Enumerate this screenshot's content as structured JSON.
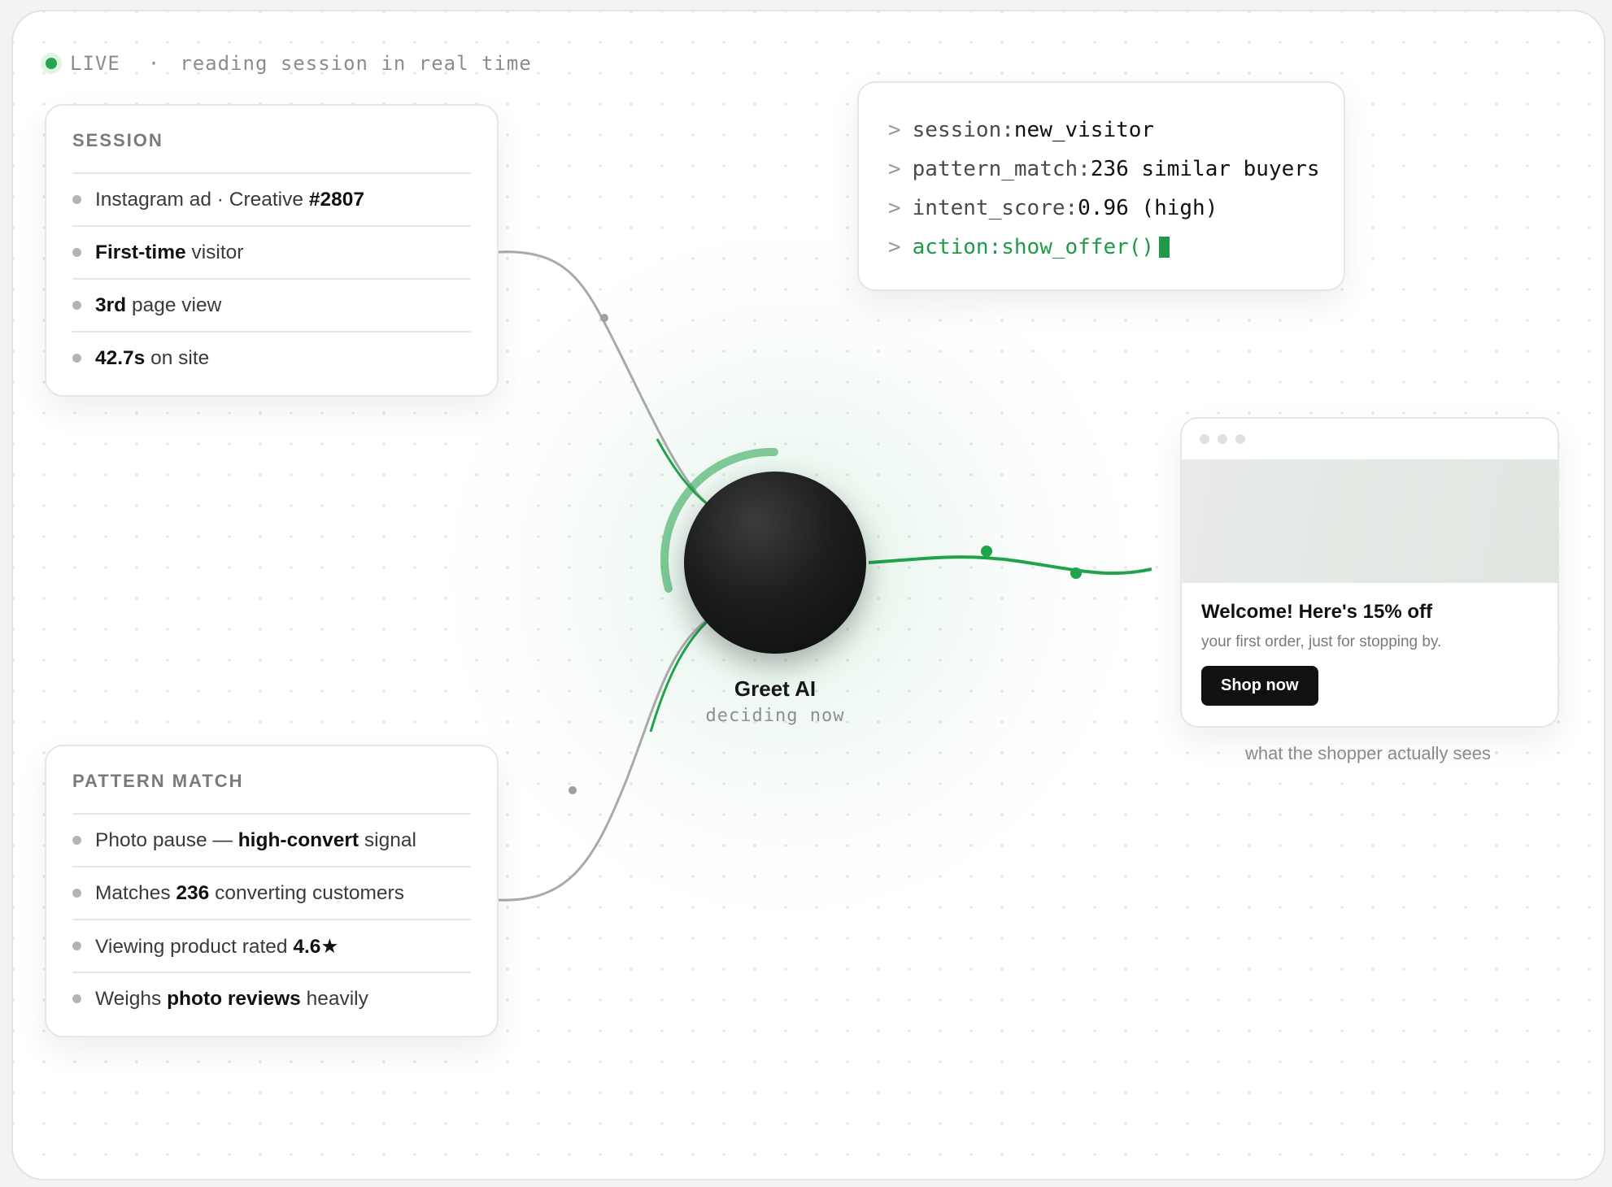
{
  "status": {
    "live_label": "LIVE",
    "separator": "·",
    "message": "reading session in real time"
  },
  "session_panel": {
    "title": "SESSION",
    "items": [
      {
        "pre": "Instagram ad · Creative ",
        "bold": "#2807",
        "post": ""
      },
      {
        "pre": "",
        "bold": "First-time",
        "post": " visitor"
      },
      {
        "pre": "",
        "bold": "3rd",
        "post": " page view"
      },
      {
        "pre": "",
        "bold": "42.7s",
        "post": " on site"
      }
    ]
  },
  "pattern_panel": {
    "title": "PATTERN MATCH",
    "items": [
      {
        "pre": "Photo pause — ",
        "bold": "high-convert",
        "post": " signal"
      },
      {
        "pre": "Matches ",
        "bold": "236",
        "post": " converting customers"
      },
      {
        "pre": "Viewing product rated ",
        "bold": "4.6★",
        "post": ""
      },
      {
        "pre": "Weighs ",
        "bold": "photo reviews",
        "post": " heavily"
      }
    ]
  },
  "terminal": {
    "prompt": ">",
    "lines": [
      {
        "key": "session:",
        "value": "new_visitor"
      },
      {
        "key": "pattern_match:",
        "value": "236 similar buyers"
      },
      {
        "key": "intent_score:",
        "value": "0.96 (high)"
      },
      {
        "key": "action:",
        "value": "show_offer()"
      }
    ]
  },
  "agent": {
    "name": "Greet AI",
    "status": "deciding now"
  },
  "offer_preview": {
    "title": "Welcome! Here's 15% off",
    "subtitle": "your first order, just for stopping by.",
    "button_label": "Shop now",
    "caption": "what the shopper actually sees"
  },
  "colors": {
    "accent": "#20a84a",
    "ink": "#111111",
    "muted": "#8a8a88"
  }
}
